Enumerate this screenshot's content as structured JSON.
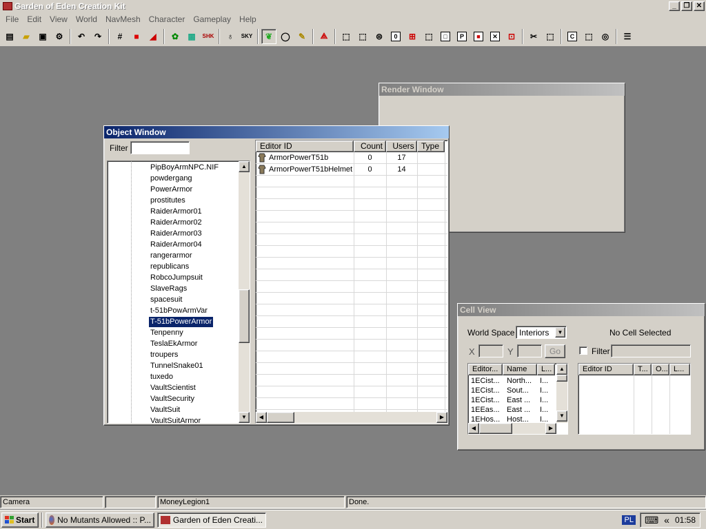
{
  "app": {
    "title": "Garden of Eden Creation Kit"
  },
  "menu": [
    "File",
    "Edit",
    "View",
    "World",
    "NavMesh",
    "Character",
    "Gameplay",
    "Help"
  ],
  "render_window": {
    "title": "Render Window"
  },
  "object_window": {
    "title": "Object Window",
    "filter_label": "Filter",
    "filter_value": "",
    "tree_items": [
      "PipBoyArmNPC.NIF",
      "powdergang",
      "PowerArmor",
      "prostitutes",
      "RaiderArmor01",
      "RaiderArmor02",
      "RaiderArmor03",
      "RaiderArmor04",
      "rangerarmor",
      "republicans",
      "RobcoJumpsuit",
      "SlaveRags",
      "spacesuit",
      "t-51bPowArmVar",
      "T-51bPowerArmor",
      "Tenpenny",
      "TeslaEkArmor",
      "troupers",
      "TunnelSnake01",
      "tuxedo",
      "VaultScientist",
      "VaultSecurity",
      "VaultSuit",
      "VaultSuitArmor"
    ],
    "selected_tree_item": "T-51bPowerArmor",
    "columns": [
      "Editor ID",
      "Count",
      "Users",
      "Type"
    ],
    "rows": [
      {
        "editor_id": "ArmorPowerT51b",
        "count": "0",
        "users": "17",
        "type": ""
      },
      {
        "editor_id": "ArmorPowerT51bHelmet",
        "count": "0",
        "users": "14",
        "type": ""
      }
    ]
  },
  "cell_view": {
    "title": "Cell View",
    "world_space_label": "World Space",
    "world_space_value": "Interiors",
    "no_cell": "No Cell Selected",
    "x_label": "X",
    "y_label": "Y",
    "go_label": "Go",
    "filter_label": "Filter",
    "left_columns": [
      "Editor...",
      "Name",
      "L..."
    ],
    "left_rows": [
      [
        "1ECist...",
        "North...",
        "I..."
      ],
      [
        "1ECist...",
        "Sout...",
        "I..."
      ],
      [
        "1ECist...",
        "East ...",
        "I..."
      ],
      [
        "1EEas...",
        "East ...",
        "I..."
      ],
      [
        "1EHos...",
        "Host...",
        "I..."
      ]
    ],
    "right_columns": [
      "Editor ID",
      "T...",
      "O...",
      "L..."
    ]
  },
  "status_bar": [
    "Camera",
    "",
    "MoneyLegion1",
    "Done."
  ],
  "taskbar": {
    "start": "Start",
    "tasks": [
      "No Mutants Allowed :: P...",
      "Garden of Eden Creati..."
    ],
    "lang": "PL",
    "collapse": "«",
    "clock": "01:58"
  }
}
